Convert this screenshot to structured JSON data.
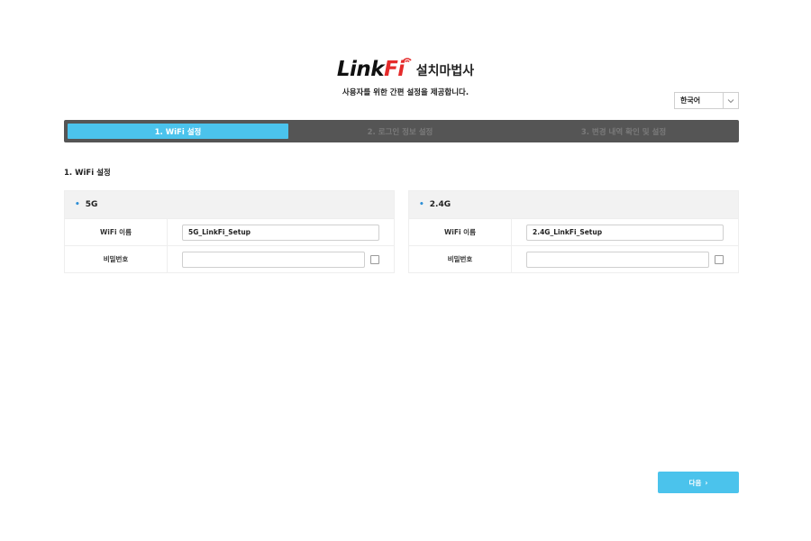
{
  "header": {
    "logo_link": "Link",
    "logo_fi": "Fi",
    "wizard_name": "설치마법사",
    "subtitle": "사용자를 위한 간편 설정을 제공합니다."
  },
  "language": {
    "selected": "한국어",
    "icon": "chevron-down-icon"
  },
  "steps": [
    {
      "label": "1. WiFi 설정",
      "active": true
    },
    {
      "label": "2. 로그인 정보 설정",
      "active": false
    },
    {
      "label": "3. 변경 내역 확인 및 설정",
      "active": false
    }
  ],
  "section_title": "1. WiFi 설정",
  "panels": {
    "band_5g": {
      "title": "5G",
      "ssid_label": "WiFi 이름",
      "ssid_value": "5G_LinkFi_Setup",
      "password_label": "비밀번호",
      "password_value": ""
    },
    "band_24g": {
      "title": "2.4G",
      "ssid_label": "WiFi 이름",
      "ssid_value": "2.4G_LinkFi_Setup",
      "password_label": "비밀번호",
      "password_value": ""
    }
  },
  "next_button": {
    "label": "다음",
    "arrow": "›"
  },
  "colors": {
    "accent": "#4bc3ec",
    "stepbar": "#555555",
    "brand_red": "#e52b2b",
    "dot": "#2f8fd5"
  }
}
